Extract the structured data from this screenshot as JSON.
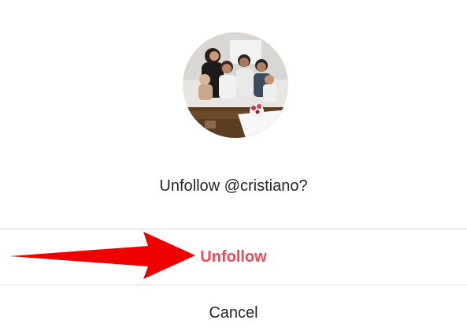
{
  "dialog": {
    "avatar_alt": "cristiano profile picture",
    "prompt": "Unfollow @cristiano?",
    "unfollow_label": "Unfollow",
    "cancel_label": "Cancel"
  },
  "annotation": {
    "icon": "arrow-right-icon",
    "color": "#ee0000"
  },
  "colors": {
    "danger": "#ed4956",
    "text": "#262626",
    "divider": "#dbdbdb"
  }
}
